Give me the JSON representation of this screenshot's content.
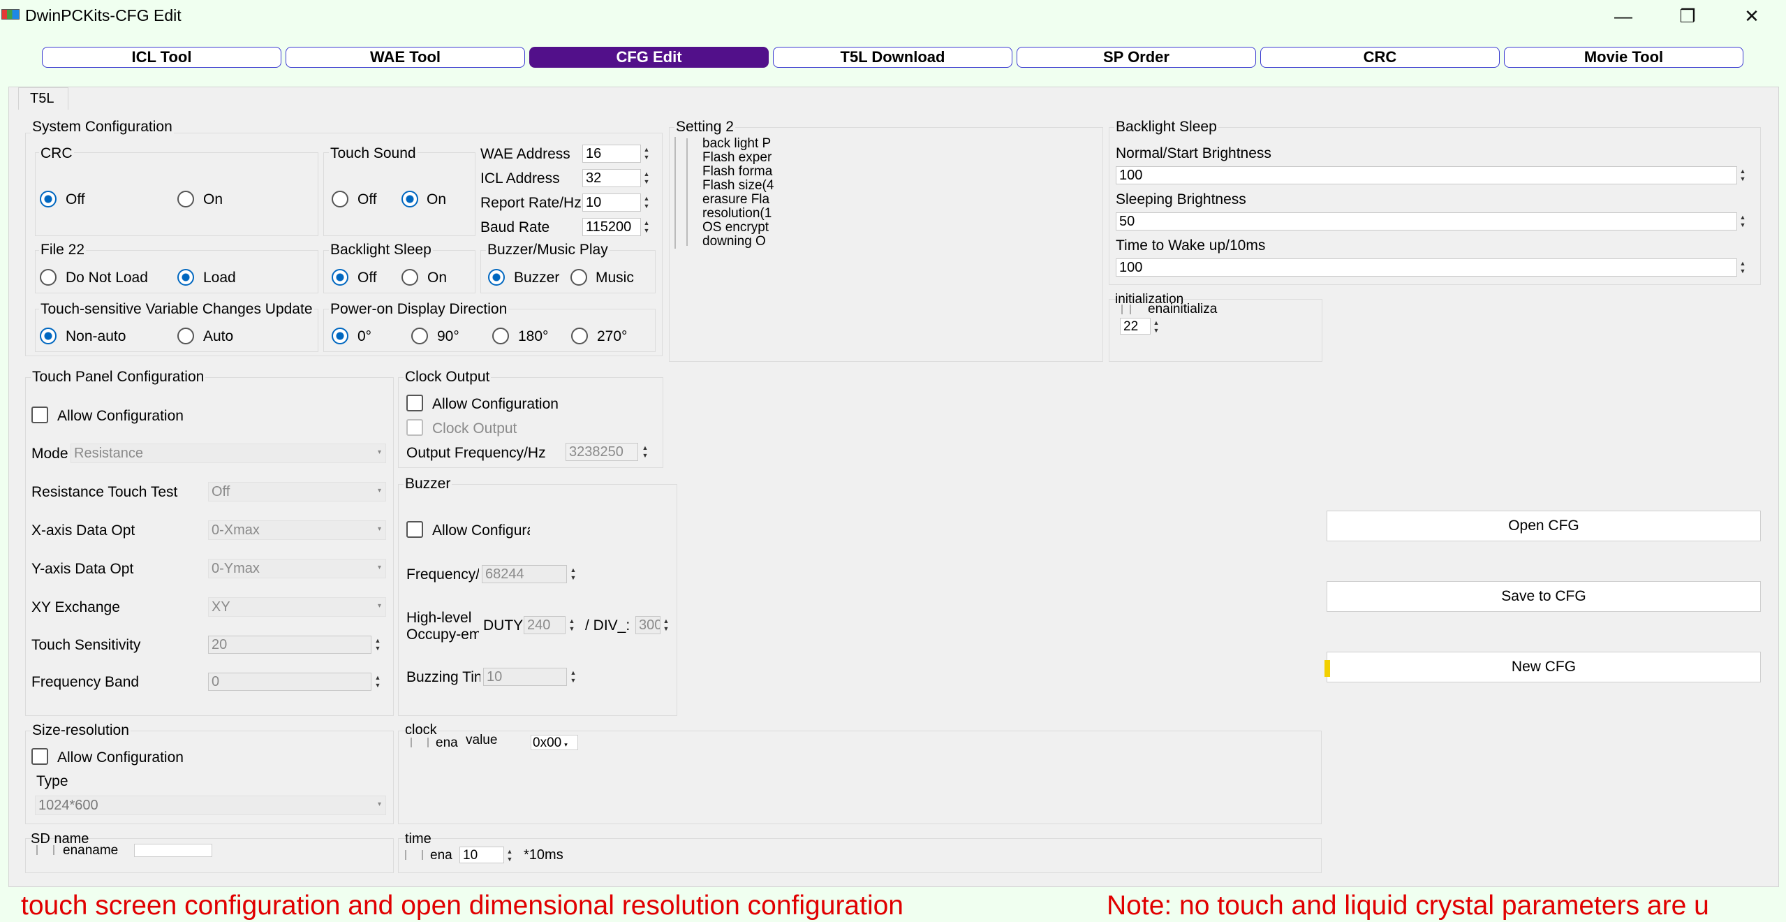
{
  "window": {
    "title": "DwinPCKits-CFG Edit"
  },
  "nav": [
    "ICL Tool",
    "WAE Tool",
    "CFG Edit",
    "T5L Download",
    "SP Order",
    "CRC",
    "Movie Tool"
  ],
  "tab": "T5L",
  "system_config": {
    "title": "System Configuration",
    "crc": {
      "title": "CRC",
      "off": "Off",
      "on": "On"
    },
    "touch_sound": {
      "title": "Touch Sound",
      "off": "Off",
      "on": "On"
    },
    "wae_address": {
      "label": "WAE Address",
      "value": "16"
    },
    "icl_address": {
      "label": "ICL Address",
      "value": "32"
    },
    "report_rate": {
      "label": "Report Rate/Hz",
      "value": "10"
    },
    "baud_rate": {
      "label": "Baud Rate",
      "value": "115200"
    },
    "file22": {
      "title": "File 22",
      "not_load": "Do Not Load",
      "load": "Load"
    },
    "backlight_sleep": {
      "title": "Backlight Sleep",
      "off": "Off",
      "on": "On"
    },
    "buzzer_music": {
      "title": "Buzzer/Music Play",
      "buzzer": "Buzzer",
      "music": "Music"
    },
    "touch_var": {
      "title": "Touch-sensitive Variable Changes Update",
      "non_auto": "Non-auto",
      "auto": "Auto"
    },
    "power_dir": {
      "title": "Power-on Display Direction",
      "d0": "0°",
      "d90": "90°",
      "d180": "180°",
      "d270": "270°"
    }
  },
  "setting2": {
    "title": "Setting 2",
    "items": [
      "back light P",
      "Flash exper",
      "Flash forma",
      "Flash size(4",
      "erasure Fla",
      "resolution(1",
      "OS encrypt",
      "downing O"
    ]
  },
  "backlight_panel": {
    "title": "Backlight Sleep",
    "normal_label": "Normal/Start Brightness",
    "normal_value": "100",
    "sleep_label": "Sleeping Brightness",
    "sleep_value": "50",
    "wake_label": "Time to Wake up/10ms",
    "wake_value": "100"
  },
  "initialization": {
    "title": "initialization",
    "check_label": "enainitializa",
    "value": "22"
  },
  "touch_panel": {
    "title": "Touch Panel Configuration",
    "allow": "Allow Configuration",
    "mode_label": "Mode",
    "mode_value": "Resistance",
    "rtt_label": "Resistance Touch Test",
    "rtt_value": "Off",
    "x_label": "X-axis Data Opt",
    "x_value": "0-Xmax",
    "y_label": "Y-axis Data Opt",
    "y_value": "0-Ymax",
    "xy_label": "XY Exchange",
    "xy_value": "XY",
    "sens_label": "Touch Sensitivity",
    "sens_value": "20",
    "band_label": "Frequency Band",
    "band_value": "0"
  },
  "clock_output": {
    "title": "Clock Output",
    "allow": "Allow Configuration",
    "clock": "Clock Output",
    "freq_label": "Output Frequency/Hz",
    "freq_value": "3238250"
  },
  "buzzer": {
    "title": "Buzzer",
    "allow": "Allow Configura",
    "freq_label": "Frequency/",
    "freq_value": "68244",
    "high_label1": "High-level",
    "high_label2": "Occupy-em",
    "duty_label": "DUTY",
    "duty_value": "240",
    "div_label": "/ DIV_:",
    "div_value": "300",
    "time_label": "Buzzing Tin",
    "time_value": "10"
  },
  "size_res": {
    "title": "Size-resolution",
    "allow": "Allow Configuration",
    "type_label": "Type",
    "type_value": "1024*600"
  },
  "clock": {
    "title": "clock",
    "ena": "ena",
    "value_label": "value",
    "value": "0x00"
  },
  "sd_name": {
    "title": "SD name",
    "ena": "enaname"
  },
  "time": {
    "title": "time",
    "ena": "ena",
    "value": "10",
    "unit": "*10ms"
  },
  "buttons": {
    "open": "Open CFG",
    "save": "Save to CFG",
    "new": "New CFG"
  },
  "notes": {
    "left": "touch screen configuration and open dimensional resolution configuration",
    "right": "Note: no touch and liquid crystal parameters are u"
  },
  "colors": {
    "accent": "#52108a",
    "nav_border": "#3a3ad0",
    "radio": "#0067c0",
    "note": "#e00000",
    "bg": "#f0fff0"
  }
}
